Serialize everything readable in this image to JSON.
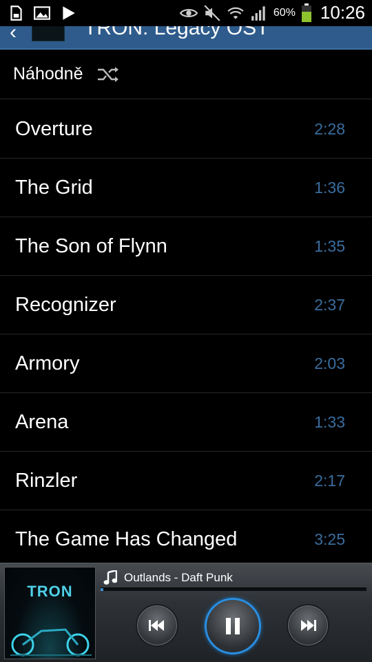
{
  "status_bar": {
    "battery_text": "60%",
    "time": "10:26",
    "icons": [
      "sd-card-icon",
      "image-icon",
      "play-notification-icon",
      "eye-icon",
      "mute-icon",
      "wifi-icon",
      "signal-icon",
      "battery-icon"
    ]
  },
  "action_bar": {
    "title": "TRON: Legacy OST"
  },
  "shuffle": {
    "label": "Náhodně"
  },
  "tracks": [
    {
      "title": "Overture",
      "duration": "2:28"
    },
    {
      "title": "The Grid",
      "duration": "1:36"
    },
    {
      "title": "The Son of Flynn",
      "duration": "1:35"
    },
    {
      "title": "Recognizer",
      "duration": "2:37"
    },
    {
      "title": "Armory",
      "duration": "2:03"
    },
    {
      "title": "Arena",
      "duration": "1:33"
    },
    {
      "title": "Rinzler",
      "duration": "2:17"
    },
    {
      "title": "The Game Has Changed",
      "duration": "3:25"
    }
  ],
  "player": {
    "now_playing": "Outlands - Daft Punk",
    "cover_logo": "TRON",
    "progress_fraction": 0.01,
    "accent_color": "#2a8ee0"
  },
  "colors": {
    "action_bar": "#2e5b8b",
    "duration_text": "#3a6d9e"
  }
}
